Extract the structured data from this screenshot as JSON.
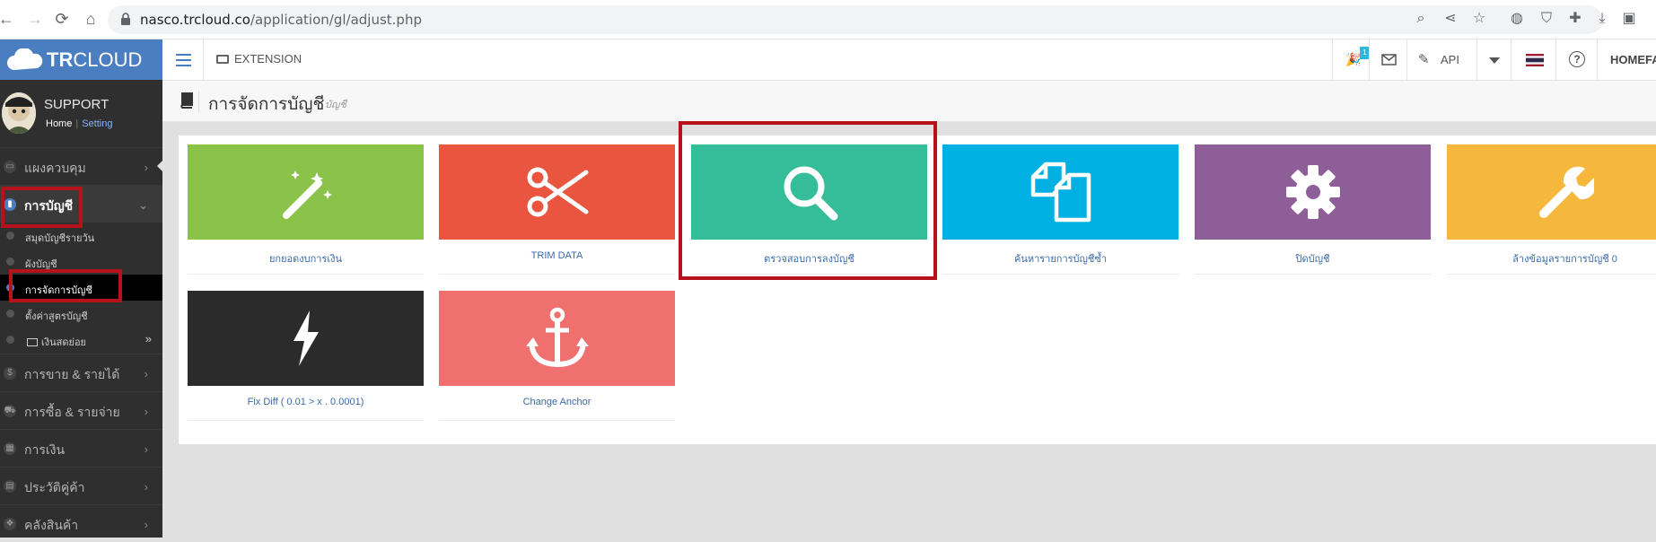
{
  "browser": {
    "url_host": "nasco.trcloud.co",
    "url_path": "/application/gl/adjust.php"
  },
  "brand": {
    "name_bold": "TR",
    "name_rest": "CLOUD"
  },
  "profile": {
    "name": "SUPPORT",
    "home_link": "Home",
    "setting_link": "Setting"
  },
  "sidebar": {
    "items": [
      {
        "label": "แผงควบคุม"
      },
      {
        "label": "การบัญชี"
      },
      {
        "label": "การขาย & รายได้"
      },
      {
        "label": "การซื้อ & รายจ่าย"
      },
      {
        "label": "การเงิน"
      },
      {
        "label": "ประวัติคู่ค้า"
      },
      {
        "label": "คลังสินค้า"
      }
    ],
    "sub_items": [
      {
        "label": "สมุดบัญชีรายวัน"
      },
      {
        "label": "ผังบัญชี"
      },
      {
        "label": "การจัดการบัญชี"
      },
      {
        "label": "ตั้งค่าสูตรบัญชี"
      },
      {
        "label": "เงินสดย่อย"
      }
    ],
    "sub_expand_icon": "»"
  },
  "topbar": {
    "extension_label": "EXTENSION",
    "notification_count": "1",
    "api_label": "API",
    "company_label": "HOMEFA"
  },
  "page": {
    "title": "การจัดการบัญชี",
    "subtitle": "บัญชี"
  },
  "tiles": [
    {
      "label": "ยกยอดงบการเงิน",
      "color": "#8bc34a",
      "icon": "magic-wand-icon"
    },
    {
      "label": "TRIM DATA",
      "color": "#e9553f",
      "icon": "scissors-icon"
    },
    {
      "label": "ตรวจสอบการลงบัญชี",
      "color": "#35bc99",
      "icon": "search-icon"
    },
    {
      "label": "ค้นหารายการบัญชีซ้ำ",
      "color": "#00b0e3",
      "icon": "copy-icon"
    },
    {
      "label": "ปิดบัญชี",
      "color": "#8d5e97",
      "icon": "gear-icon"
    },
    {
      "label": "ล้างข้อมูลรายการบัญชี 0",
      "color": "#f5b73c",
      "icon": "wrench-icon"
    },
    {
      "label": "Fix Diff ( 0.01 > x . 0.0001)",
      "color": "#2b2b2b",
      "icon": "bolt-icon"
    },
    {
      "label": "Change Anchor",
      "color": "#f07070",
      "icon": "anchor-icon"
    }
  ],
  "colors": {
    "brand_blue": "#4a7ec1",
    "sidebar_bg": "#2f2f2f",
    "highlight_red": "#b5121b"
  }
}
